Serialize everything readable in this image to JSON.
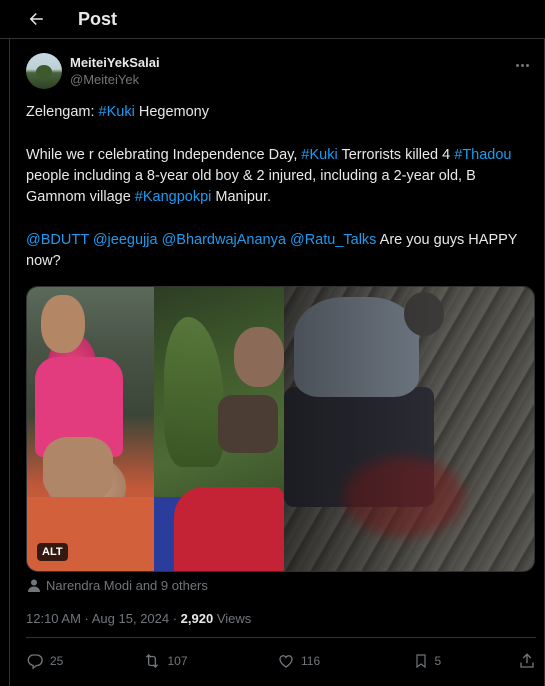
{
  "header": {
    "title": "Post"
  },
  "author": {
    "display_name": "MeiteiYekSalai",
    "handle": "@MeiteiYek"
  },
  "tweet": {
    "line1": {
      "prefix": "Zelengam: ",
      "hashtag": "#Kuki",
      "suffix": " Hegemony"
    },
    "line2": {
      "part1": "While we r celebrating Independence Day, ",
      "hashtag1": "#Kuki",
      "part2": " Terrorists killed 4 ",
      "hashtag2": "#Thadou",
      "part3": " people including a 8-year old boy & 2 injured, including a 2-year old, B Gamnom village ",
      "hashtag3": "#Kangpokpi",
      "part4": " Manipur."
    },
    "line3": {
      "mention1": "@BDUTT",
      "mention2": "@jeegujja",
      "mention3": "@BhardwajAnanya",
      "mention4": "@Ratu_Talks",
      "suffix": " Are you guys HAPPY now?"
    }
  },
  "media": {
    "alt_label": "ALT"
  },
  "tagged": {
    "text": "Narendra Modi and 9 others"
  },
  "meta": {
    "time": "12:10 AM · Aug 15, 2024 · ",
    "views_count": "2,920",
    "views_label": " Views"
  },
  "actions": {
    "replies": "25",
    "reposts": "107",
    "likes": "116",
    "bookmarks": "5"
  },
  "colors": {
    "background": "#000000",
    "text": "#e7e9ea",
    "muted": "#71767b",
    "link": "#1d9bf0",
    "border": "#2f3336"
  }
}
